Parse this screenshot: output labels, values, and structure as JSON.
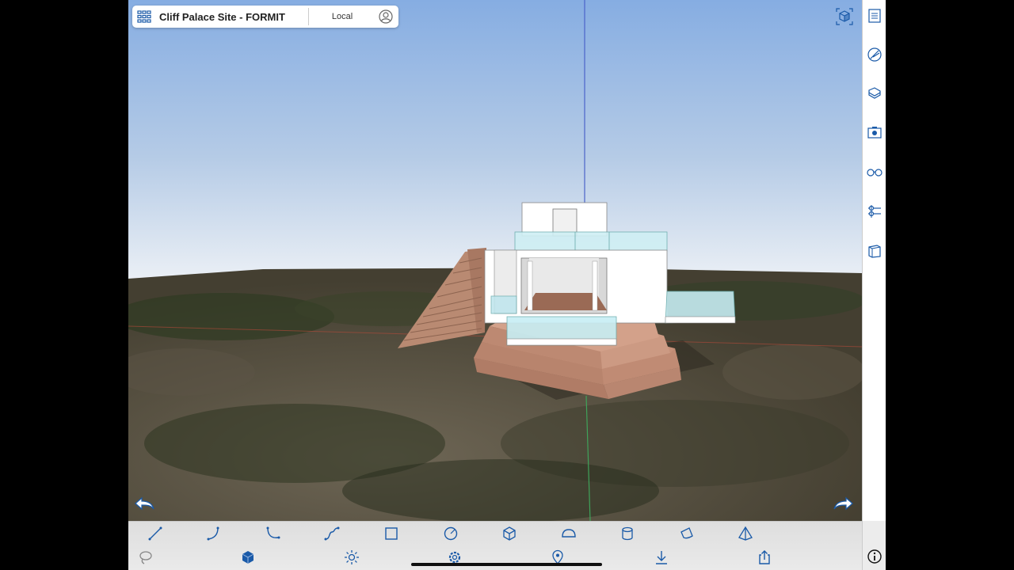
{
  "header": {
    "title": "Cliff Palace Site - FORMIT",
    "location": "Local"
  },
  "icons": {
    "grid": "grid-menu-icon",
    "user": "user-account-icon",
    "view_cube": "view-cube-icon",
    "undo": "undo-arrow-icon",
    "redo": "redo-arrow-icon"
  },
  "right_sidebar": [
    "properties-panel-icon",
    "materials-icon",
    "layers-icon",
    "scenes-camera-icon",
    "visual-style-glasses-icon",
    "levels-icon",
    "library-content-icon"
  ],
  "toolbar_top": [
    "line-tool-icon",
    "arc-tool-icon",
    "curve-tool-icon",
    "spline-tool-icon",
    "rectangle-tool-icon",
    "circle-tool-icon",
    "box-tool-icon",
    "dome-tool-icon",
    "cylinder-tool-icon",
    "cone-tool-icon",
    "pyramid-tool-icon"
  ],
  "toolbar_bottom": [
    "select-lasso-icon",
    "3d-model-icon",
    "sun-shadows-icon",
    "settings-gear-icon",
    "location-pin-icon",
    "import-download-icon",
    "share-export-icon",
    "info-icon"
  ],
  "colors": {
    "accent": "#1a5aa8",
    "sky_top": "#87aee0",
    "sky_horizon": "#e9eef5",
    "terrain": "#4d4a3a",
    "platform": "#c9957c",
    "building": "#ffffff",
    "glass": "#bfe8ee"
  }
}
